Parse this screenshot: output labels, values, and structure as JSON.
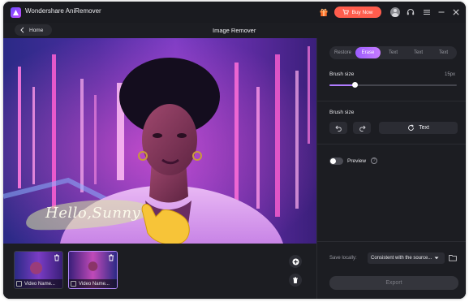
{
  "app": {
    "title": "Wondershare AniRemover"
  },
  "titlebar": {
    "buy_label": "Buy Now"
  },
  "header": {
    "home_label": "Home",
    "page_title": "Image Remover"
  },
  "canvas": {
    "overlay_text": "Hello,Sunny"
  },
  "thumbnails": [
    {
      "label": "Video Name...",
      "selected": false
    },
    {
      "label": "Video Name...",
      "selected": true
    }
  ],
  "panel": {
    "tabs": [
      {
        "label": "Restore",
        "active": false
      },
      {
        "label": "Erase",
        "active": true
      },
      {
        "label": "Text",
        "active": false
      },
      {
        "label": "Text",
        "active": false
      },
      {
        "label": "Text",
        "active": false
      }
    ],
    "brush_size_label": "Brush size",
    "brush_size_value": "15px",
    "brush_size_fraction": 0.2,
    "brush_size_label_2": "Brush size",
    "text_button_label": "Text",
    "preview_label": "Preview",
    "preview_enabled": false,
    "save_locally_label": "Save locally:",
    "save_locally_value": "Consistent with the source...",
    "export_label": "Export"
  },
  "colors": {
    "accent": "#a86bff",
    "buy": "#ff5d4d",
    "background": "#1c1d22"
  }
}
